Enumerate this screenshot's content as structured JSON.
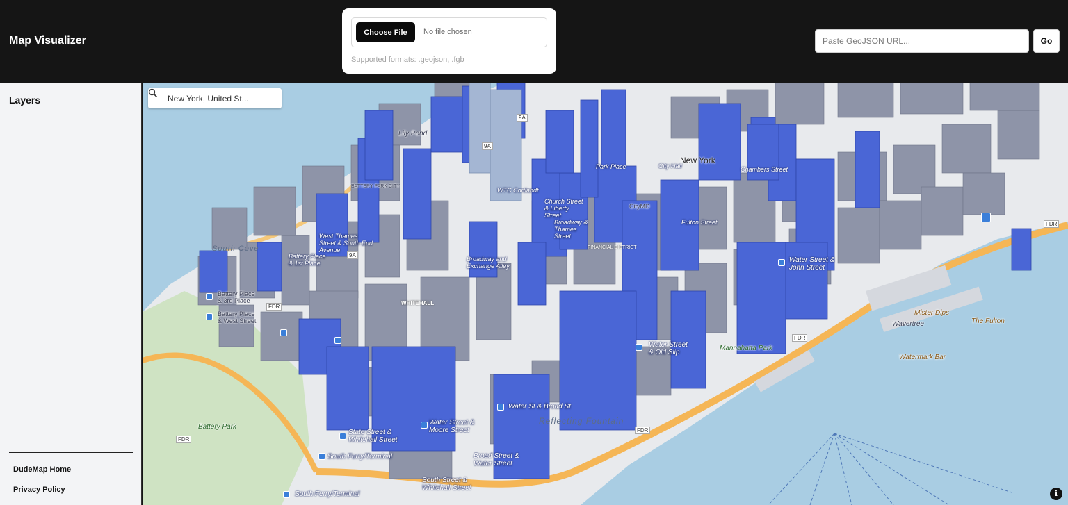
{
  "header": {
    "title": "Map Visualizer",
    "upload": {
      "button_label": "Choose File",
      "status": "No file chosen",
      "formats": "Supported formats: .geojson, .fgb"
    },
    "url": {
      "placeholder": "Paste GeoJSON URL...",
      "go_label": "Go"
    }
  },
  "sidebar": {
    "title": "Layers",
    "links": [
      {
        "label": "DudeMap Home"
      },
      {
        "label": "Privacy Policy"
      }
    ]
  },
  "map": {
    "search_value": "New York, United St...",
    "info_icon": "info-icon",
    "colors": {
      "building_highlight": "#4a66d6",
      "building_gray": "#8e94a8",
      "water": "#a9cde3",
      "land": "#e9ecef",
      "road": "#f4c06a"
    },
    "labels": {
      "city": "New York",
      "lily_pond": "Lily Pond",
      "south_cove": "South Cove",
      "battery_park_city": "BATTERY PARK CITY",
      "whitehall": "WHITEHALL",
      "financial_district": "FINANCIAL DISTRICT",
      "reflecting_fountain": "Reflecting Fountain",
      "battery_park": "Battery Park",
      "mannahatta_park": "Mannahatta Park",
      "wavertree": "Wavertree",
      "mister_dips": "Mister Dips",
      "the_fulton": "The Fulton",
      "watermark_bar": "Watermark Bar",
      "wtc_cortlandt": "WTC Cortlandt",
      "city_hall": "City Hall",
      "park_place": "Park Place",
      "chambers_street": "Chambers Street",
      "fulton_street": "Fulton Street",
      "citymd": "CityMD",
      "broad_st": "Water St & Broad St",
      "water_old_slip": "Water Street & Old Slip",
      "water_john": "Water Street & John Street",
      "state_whitehall": "State Street & Whitehall Street",
      "water_moore": "Water Street & Moore Street",
      "broad_water": "Broad Street & Water Street",
      "south_ferry": "South Ferry/Terminal",
      "south_ferry_2": "South Ferry/Terminal",
      "south_whitehall": "South Street & Whitehall Street",
      "battery_place_1": "Battery Place & 1st Place",
      "battery_place_2": "Battery Place & 3rd Place",
      "battery_place_3": "Battery Place & West Street",
      "west_thames": "West Thames Street & South End Avenue",
      "broadway_exchange": "Broadway and Exchange Alley",
      "broadway_thames": "Broadway & Thames Street",
      "church_liberty": "Church Street & Liberty Street",
      "fdr_1": "FDR",
      "fdr_2": "FDR",
      "fdr_3": "FDR",
      "fdr_4": "FDR",
      "fdr_5": "FDR",
      "route_9a_1": "9A",
      "route_9a_2": "9A",
      "route_9a_3": "9A"
    }
  }
}
